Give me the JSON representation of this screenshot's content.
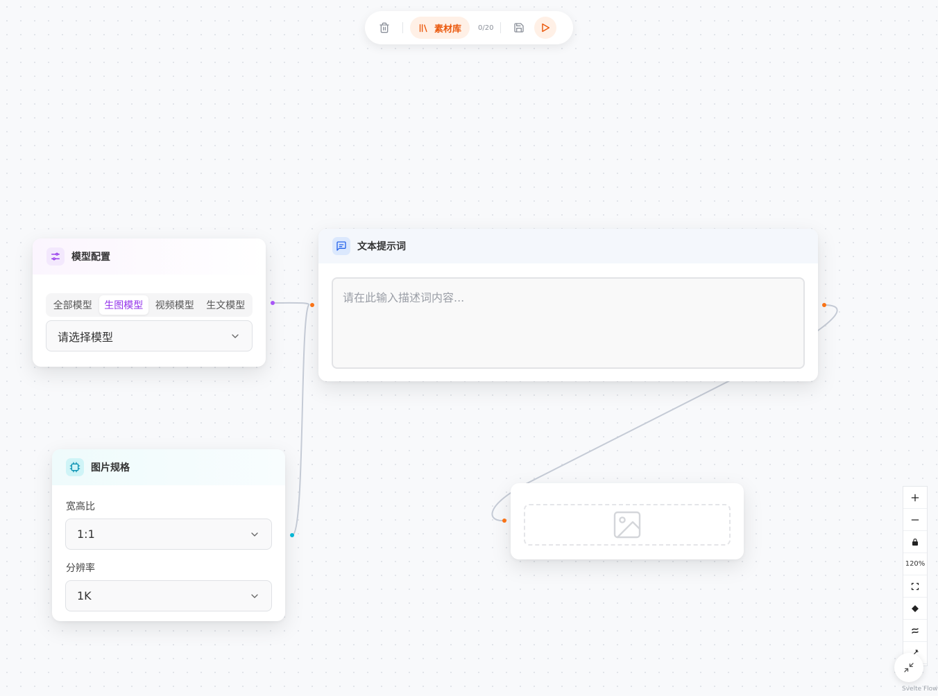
{
  "toolbar": {
    "delete_icon": "trash-icon",
    "library_label": "素材库",
    "library_icon": "library-icon",
    "count": "0/20",
    "save_icon": "save-icon",
    "run_icon": "play-icon"
  },
  "model_node": {
    "title": "模型配置",
    "icon": "sliders-icon",
    "tabs": [
      {
        "label": "全部模型",
        "active": false
      },
      {
        "label": "生图模型",
        "active": true
      },
      {
        "label": "视频模型",
        "active": false
      },
      {
        "label": "生文模型",
        "active": false
      }
    ],
    "select_placeholder": "请选择模型"
  },
  "text_node": {
    "title": "文本提示词",
    "icon": "message-icon",
    "placeholder": "请在此输入描述词内容..."
  },
  "spec_node": {
    "title": "图片规格",
    "icon": "frame-icon",
    "aspect_label": "宽高比",
    "aspect_value": "1:1",
    "resolution_label": "分辨率",
    "resolution_value": "1K"
  },
  "image_node": {
    "icon": "image-icon"
  },
  "controls": {
    "zoom_in": "+",
    "zoom_out": "−",
    "zoom_level": "120%"
  },
  "attribution": "Svelte Flow",
  "colors": {
    "accent_orange": "#ea580c",
    "accent_purple": "#9333ea",
    "accent_blue": "#3b82f6",
    "accent_cyan": "#0891b2"
  }
}
